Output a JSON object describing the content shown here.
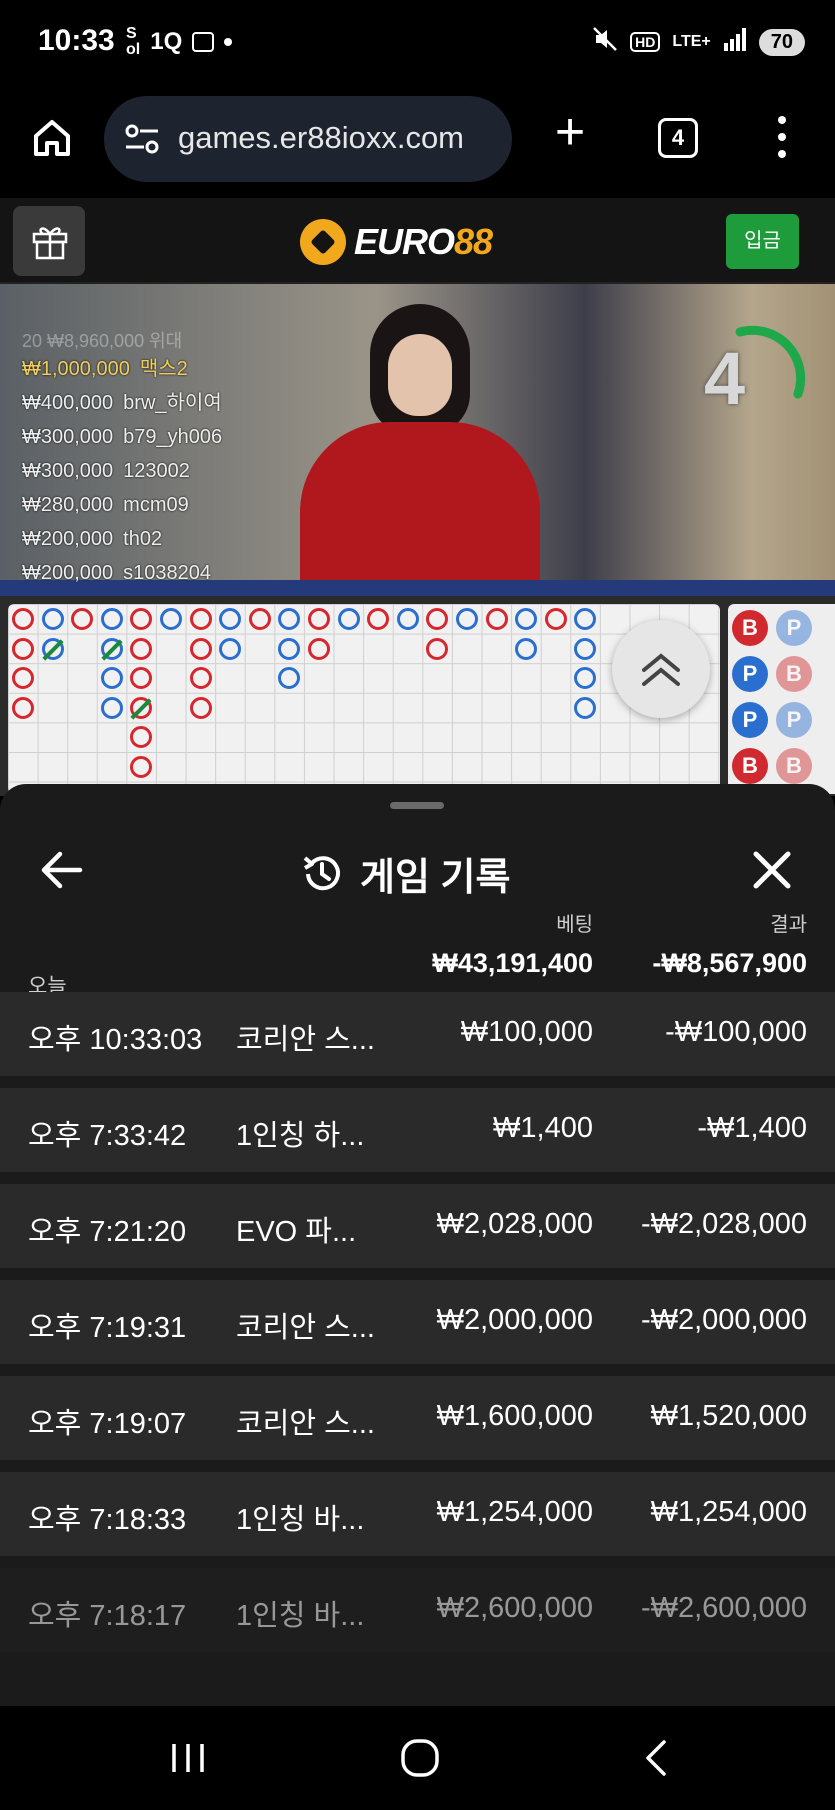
{
  "status_bar": {
    "time": "10:33",
    "icons_left": [
      "super-sol-icon",
      "1q-icon",
      "screen-capture-icon",
      "dot-icon"
    ],
    "icons_right": [
      "mute-icon",
      "hd-icon",
      "lte-icon",
      "signal-icon"
    ],
    "battery": "70"
  },
  "browser": {
    "url": "games.er88ioxx.com",
    "tab_count": "4"
  },
  "site": {
    "logo_a": "EURO",
    "logo_b": "88",
    "deposit_label": "입금",
    "accent": "#f2a81d",
    "deposit_color": "#1e9c3b"
  },
  "live": {
    "faded_line": "20 ₩8,960,000 위대",
    "leaders": [
      {
        "amount": "₩1,000,000",
        "name": "맥스2"
      },
      {
        "amount": "₩400,000",
        "name": "brw_하이여"
      },
      {
        "amount": "₩300,000",
        "name": "b79_yh006"
      },
      {
        "amount": "₩300,000",
        "name": "123002"
      },
      {
        "amount": "₩280,000",
        "name": "mcm09"
      },
      {
        "amount": "₩200,000",
        "name": "th02"
      },
      {
        "amount": "₩200,000",
        "name": "s1038204"
      }
    ],
    "countdown": "4"
  },
  "roadmap": {
    "bead_labels": [
      "B",
      "P",
      "P",
      "B",
      "P",
      "P",
      "B",
      "B"
    ],
    "colors": {
      "banker": "#d6272e",
      "player": "#2a6fd0"
    }
  },
  "sheet": {
    "title": "게임 기록",
    "col_bet": "베팅",
    "col_result": "결과",
    "today_label": "오늘",
    "total_bet": "₩43,191,400",
    "total_result": "-₩8,567,900",
    "records": [
      {
        "time": "오후 10:33:03",
        "game": "코리안 스...",
        "bet": "₩100,000",
        "result": "-₩100,000"
      },
      {
        "time": "오후 7:33:42",
        "game": "1인칭 하...",
        "bet": "₩1,400",
        "result": "-₩1,400"
      },
      {
        "time": "오후 7:21:20",
        "game": "EVO 파...",
        "bet": "₩2,028,000",
        "result": "-₩2,028,000"
      },
      {
        "time": "오후 7:19:31",
        "game": "코리안 스...",
        "bet": "₩2,000,000",
        "result": "-₩2,000,000"
      },
      {
        "time": "오후 7:19:07",
        "game": "코리안 스...",
        "bet": "₩1,600,000",
        "result": "₩1,520,000"
      },
      {
        "time": "오후 7:18:33",
        "game": "1인칭 바...",
        "bet": "₩1,254,000",
        "result": "₩1,254,000"
      },
      {
        "time": "오후 7:18:17",
        "game": "1인칭 바...",
        "bet": "₩2,600,000",
        "result": "-₩2,600,000"
      }
    ]
  }
}
